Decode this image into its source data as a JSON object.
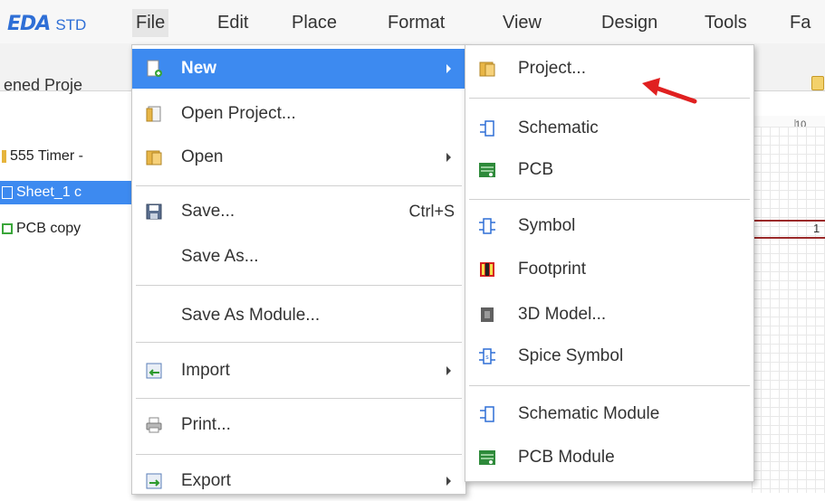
{
  "app": {
    "logo_main": "EDA",
    "logo_sub": "STD"
  },
  "menubar": {
    "items": [
      "File",
      "Edit",
      "Place",
      "Format",
      "View",
      "Design",
      "Tools",
      "Fa"
    ]
  },
  "left_panel": {
    "title": "ened Proje",
    "tree": [
      {
        "label": "555 Timer -",
        "icon": "folder-icon"
      },
      {
        "label": "Sheet_1 c",
        "icon": "schematic-icon",
        "selected": true
      },
      {
        "label": "PCB copy",
        "icon": "pcb-icon"
      }
    ]
  },
  "ruler": {
    "label": "10"
  },
  "canvas": {
    "marker": "1"
  },
  "file_menu": {
    "items": [
      {
        "label": "New",
        "icon": "new-file-icon",
        "submenu": true,
        "highlight": true
      },
      {
        "label": "Open Project...",
        "icon": "open-project-icon"
      },
      {
        "label": "Open",
        "icon": "folder-icon",
        "submenu": true
      },
      {
        "label": "Save...",
        "icon": "save-icon",
        "shortcut": "Ctrl+S"
      },
      {
        "label": "Save As..."
      },
      {
        "label": "Save As Module..."
      },
      {
        "label": "Import",
        "icon": "import-icon",
        "submenu": true
      },
      {
        "label": "Print...",
        "icon": "print-icon"
      },
      {
        "label": "Export",
        "icon": "export-icon",
        "submenu": true
      }
    ]
  },
  "new_menu": {
    "items": [
      {
        "label": "Project...",
        "icon": "folder-icon"
      },
      {
        "label": "Schematic",
        "icon": "schematic-icon"
      },
      {
        "label": "PCB",
        "icon": "pcb-icon"
      },
      {
        "label": "Symbol",
        "icon": "symbol-icon"
      },
      {
        "label": "Footprint",
        "icon": "footprint-icon"
      },
      {
        "label": "3D Model...",
        "icon": "3d-model-icon"
      },
      {
        "label": "Spice Symbol",
        "icon": "spice-symbol-icon"
      },
      {
        "label": "Schematic Module",
        "icon": "schematic-icon"
      },
      {
        "label": "PCB Module",
        "icon": "pcb-icon"
      }
    ]
  },
  "colors": {
    "accent": "#3d8af0",
    "logo": "#2f6fd6",
    "annotation_arrow": "#e02020"
  }
}
